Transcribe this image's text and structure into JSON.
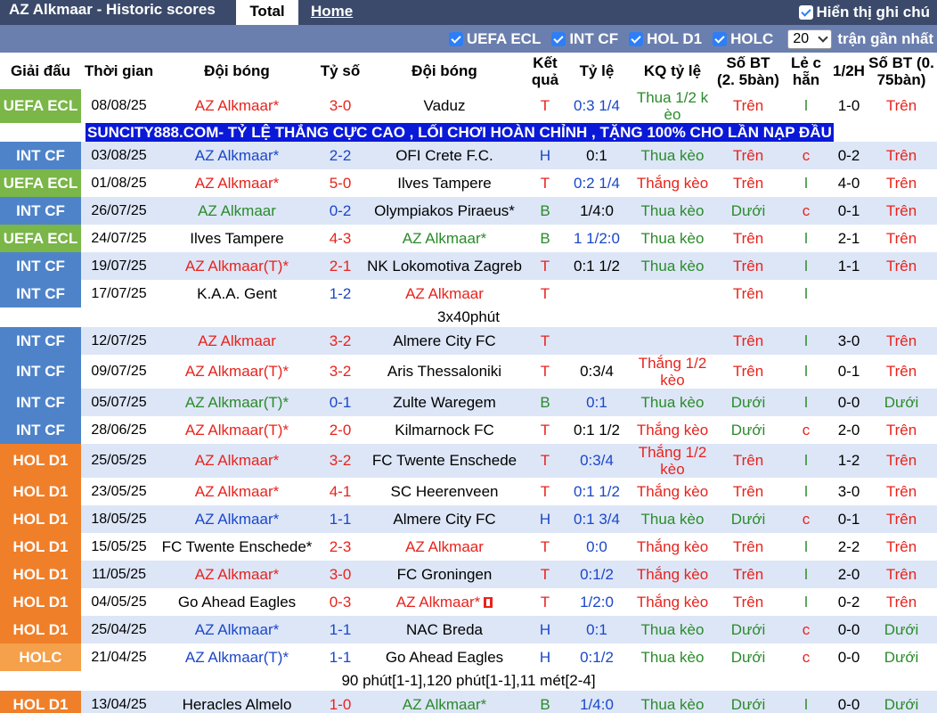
{
  "header": {
    "title": "AZ Alkmaar - Historic scores",
    "tab_total": "Total",
    "tab_home": "Home",
    "show_label": "Hiển thị ghi chú"
  },
  "filters": {
    "items": [
      "UEFA ECL",
      "INT CF",
      "HOL D1",
      "HOLC"
    ],
    "count": "20",
    "recent_label": "trận gần nhất"
  },
  "columns": [
    "Giải đấu",
    "Thời gian",
    "Đội bóng",
    "Tỷ số",
    "Đội bóng",
    "Kết quả",
    "Tỷ lệ",
    "KQ tỷ lệ",
    "Số BT (2. 5bàn)",
    "Lẻ c hẵn",
    "1/2H",
    "Số BT (0. 75bàn)"
  ],
  "colors": {
    "UEFA ECL": "#7ab648",
    "INT CF": "#4e83c9",
    "HOL D1": "#f07f2a",
    "HOLC": "#f5a04a",
    "red": "#e8231c",
    "blue": "#1a47c9",
    "green": "#2a8b2a"
  },
  "banner": "SUNCITY888.COM- TỶ LỆ THẮNG CỰC CAO , LỐI CHƠI HOÀN CHỈNH , TẶNG 100% CHO LẦN NẠP ĐẦU",
  "rows": [
    {
      "kind": "match",
      "league": "UEFA ECL",
      "date": "08/08/25",
      "home": "AZ Alkmaar*",
      "home_c": "red",
      "score": "3-0",
      "score_c": "red",
      "away": "Vaduz",
      "away_c": "",
      "res": "T",
      "res_c": "red",
      "odds": "0:3 1/4",
      "odds_c": "blue",
      "kq": "Thua 1/2 k èo",
      "kq_c": "green",
      "ou": "Trên",
      "ou_c": "red",
      "oe": "l",
      "oe_c": "green",
      "half": "1-0",
      "ou2": "Trên",
      "ou2_c": "red",
      "tall": true
    },
    {
      "kind": "banner"
    },
    {
      "kind": "match",
      "league": "INT CF",
      "date": "03/08/25",
      "home": "AZ Alkmaar*",
      "home_c": "blue",
      "score": "2-2",
      "score_c": "blue",
      "away": "OFI Crete F.C.",
      "away_c": "",
      "res": "H",
      "res_c": "blue",
      "odds": "0:1",
      "odds_c": "",
      "kq": "Thua kèo",
      "kq_c": "green",
      "ou": "Trên",
      "ou_c": "red",
      "oe": "c",
      "oe_c": "red",
      "half": "0-2",
      "ou2": "Trên",
      "ou2_c": "red"
    },
    {
      "kind": "match",
      "league": "UEFA ECL",
      "date": "01/08/25",
      "home": "AZ Alkmaar*",
      "home_c": "red",
      "score": "5-0",
      "score_c": "red",
      "away": "Ilves Tampere",
      "away_c": "",
      "res": "T",
      "res_c": "red",
      "odds": "0:2 1/4",
      "odds_c": "blue",
      "kq": "Thắng kèo",
      "kq_c": "red",
      "ou": "Trên",
      "ou_c": "red",
      "oe": "l",
      "oe_c": "green",
      "half": "4-0",
      "ou2": "Trên",
      "ou2_c": "red"
    },
    {
      "kind": "match",
      "league": "INT CF",
      "date": "26/07/25",
      "home": "AZ Alkmaar",
      "home_c": "green",
      "score": "0-2",
      "score_c": "blue",
      "away": "Olympiakos Piraeus*",
      "away_c": "",
      "res": "B",
      "res_c": "green",
      "odds": "1/4:0",
      "odds_c": "",
      "kq": "Thua kèo",
      "kq_c": "green",
      "ou": "Dưới",
      "ou_c": "green",
      "oe": "c",
      "oe_c": "red",
      "half": "0-1",
      "ou2": "Trên",
      "ou2_c": "red"
    },
    {
      "kind": "match",
      "league": "UEFA ECL",
      "date": "24/07/25",
      "home": "Ilves Tampere",
      "home_c": "",
      "score": "4-3",
      "score_c": "red",
      "away": "AZ Alkmaar*",
      "away_c": "green",
      "res": "B",
      "res_c": "green",
      "odds": "1 1/2:0",
      "odds_c": "blue",
      "kq": "Thua kèo",
      "kq_c": "green",
      "ou": "Trên",
      "ou_c": "red",
      "oe": "l",
      "oe_c": "green",
      "half": "2-1",
      "ou2": "Trên",
      "ou2_c": "red"
    },
    {
      "kind": "match",
      "league": "INT CF",
      "date": "19/07/25",
      "home": "AZ Alkmaar(T)*",
      "home_c": "red",
      "score": "2-1",
      "score_c": "red",
      "away": "NK Lokomotiva Zagreb",
      "away_c": "",
      "res": "T",
      "res_c": "red",
      "odds": "0:1 1/2",
      "odds_c": "",
      "kq": "Thua kèo",
      "kq_c": "green",
      "ou": "Trên",
      "ou_c": "red",
      "oe": "l",
      "oe_c": "green",
      "half": "1-1",
      "ou2": "Trên",
      "ou2_c": "red"
    },
    {
      "kind": "match",
      "league": "INT CF",
      "date": "17/07/25",
      "home": "K.A.A. Gent",
      "home_c": "",
      "score": "1-2",
      "score_c": "blue",
      "away": "AZ Alkmaar",
      "away_c": "red",
      "res": "T",
      "res_c": "red",
      "odds": "",
      "odds_c": "",
      "kq": "",
      "kq_c": "",
      "ou": "Trên",
      "ou_c": "red",
      "oe": "l",
      "oe_c": "green",
      "half": "",
      "ou2": "",
      "ou2_c": ""
    },
    {
      "kind": "note",
      "text": "3x40phút"
    },
    {
      "kind": "match",
      "league": "INT CF",
      "date": "12/07/25",
      "home": "AZ Alkmaar",
      "home_c": "red",
      "score": "3-2",
      "score_c": "red",
      "away": "Almere City FC",
      "away_c": "",
      "res": "T",
      "res_c": "red",
      "odds": "",
      "odds_c": "",
      "kq": "",
      "kq_c": "",
      "ou": "Trên",
      "ou_c": "red",
      "oe": "l",
      "oe_c": "green",
      "half": "3-0",
      "ou2": "Trên",
      "ou2_c": "red"
    },
    {
      "kind": "match",
      "league": "INT CF",
      "date": "09/07/25",
      "home": "AZ Alkmaar(T)*",
      "home_c": "red",
      "score": "3-2",
      "score_c": "red",
      "away": "Aris Thessaloniki",
      "away_c": "",
      "res": "T",
      "res_c": "red",
      "odds": "0:3/4",
      "odds_c": "",
      "kq": "Thắng 1/2 kèo",
      "kq_c": "red",
      "ou": "Trên",
      "ou_c": "red",
      "oe": "l",
      "oe_c": "green",
      "half": "0-1",
      "ou2": "Trên",
      "ou2_c": "red",
      "tall": true
    },
    {
      "kind": "match",
      "league": "INT CF",
      "date": "05/07/25",
      "home": "AZ Alkmaar(T)*",
      "home_c": "green",
      "score": "0-1",
      "score_c": "blue",
      "away": "Zulte Waregem",
      "away_c": "",
      "res": "B",
      "res_c": "green",
      "odds": "0:1",
      "odds_c": "blue",
      "kq": "Thua kèo",
      "kq_c": "green",
      "ou": "Dưới",
      "ou_c": "green",
      "oe": "l",
      "oe_c": "green",
      "half": "0-0",
      "ou2": "Dưới",
      "ou2_c": "green"
    },
    {
      "kind": "match",
      "league": "INT CF",
      "date": "28/06/25",
      "home": "AZ Alkmaar(T)*",
      "home_c": "red",
      "score": "2-0",
      "score_c": "red",
      "away": "Kilmarnock FC",
      "away_c": "",
      "res": "T",
      "res_c": "red",
      "odds": "0:1 1/2",
      "odds_c": "",
      "kq": "Thắng kèo",
      "kq_c": "red",
      "ou": "Dưới",
      "ou_c": "green",
      "oe": "c",
      "oe_c": "red",
      "half": "2-0",
      "ou2": "Trên",
      "ou2_c": "red"
    },
    {
      "kind": "match",
      "league": "HOL D1",
      "date": "25/05/25",
      "home": "AZ Alkmaar*",
      "home_c": "red",
      "score": "3-2",
      "score_c": "red",
      "away": "FC Twente Enschede",
      "away_c": "",
      "res": "T",
      "res_c": "red",
      "odds": "0:3/4",
      "odds_c": "blue",
      "kq": "Thắng 1/2 kèo",
      "kq_c": "red",
      "ou": "Trên",
      "ou_c": "red",
      "oe": "l",
      "oe_c": "green",
      "half": "1-2",
      "ou2": "Trên",
      "ou2_c": "red",
      "tall": true
    },
    {
      "kind": "match",
      "league": "HOL D1",
      "date": "23/05/25",
      "home": "AZ Alkmaar*",
      "home_c": "red",
      "score": "4-1",
      "score_c": "red",
      "away": "SC Heerenveen",
      "away_c": "",
      "res": "T",
      "res_c": "red",
      "odds": "0:1 1/2",
      "odds_c": "blue",
      "kq": "Thắng kèo",
      "kq_c": "red",
      "ou": "Trên",
      "ou_c": "red",
      "oe": "l",
      "oe_c": "green",
      "half": "3-0",
      "ou2": "Trên",
      "ou2_c": "red"
    },
    {
      "kind": "match",
      "league": "HOL D1",
      "date": "18/05/25",
      "home": "AZ Alkmaar*",
      "home_c": "blue",
      "score": "1-1",
      "score_c": "blue",
      "away": "Almere City FC",
      "away_c": "",
      "res": "H",
      "res_c": "blue",
      "odds": "0:1 3/4",
      "odds_c": "blue",
      "kq": "Thua kèo",
      "kq_c": "green",
      "ou": "Dưới",
      "ou_c": "green",
      "oe": "c",
      "oe_c": "red",
      "half": "0-1",
      "ou2": "Trên",
      "ou2_c": "red"
    },
    {
      "kind": "match",
      "league": "HOL D1",
      "date": "15/05/25",
      "home": "FC Twente Enschede*",
      "home_c": "",
      "score": "2-3",
      "score_c": "red",
      "away": "AZ Alkmaar",
      "away_c": "red",
      "res": "T",
      "res_c": "red",
      "odds": "0:0",
      "odds_c": "blue",
      "kq": "Thắng kèo",
      "kq_c": "red",
      "ou": "Trên",
      "ou_c": "red",
      "oe": "l",
      "oe_c": "green",
      "half": "2-2",
      "ou2": "Trên",
      "ou2_c": "red"
    },
    {
      "kind": "match",
      "league": "HOL D1",
      "date": "11/05/25",
      "home": "AZ Alkmaar*",
      "home_c": "red",
      "score": "3-0",
      "score_c": "red",
      "away": "FC Groningen",
      "away_c": "",
      "res": "T",
      "res_c": "red",
      "odds": "0:1/2",
      "odds_c": "blue",
      "kq": "Thắng kèo",
      "kq_c": "red",
      "ou": "Trên",
      "ou_c": "red",
      "oe": "l",
      "oe_c": "green",
      "half": "2-0",
      "ou2": "Trên",
      "ou2_c": "red"
    },
    {
      "kind": "match",
      "league": "HOL D1",
      "date": "04/05/25",
      "home": "Go Ahead Eagles",
      "home_c": "",
      "score": "0-3",
      "score_c": "red",
      "away": "AZ Alkmaar*",
      "away_c": "red",
      "away_flag": true,
      "res": "T",
      "res_c": "red",
      "odds": "1/2:0",
      "odds_c": "blue",
      "kq": "Thắng kèo",
      "kq_c": "red",
      "ou": "Trên",
      "ou_c": "red",
      "oe": "l",
      "oe_c": "green",
      "half": "0-2",
      "ou2": "Trên",
      "ou2_c": "red"
    },
    {
      "kind": "match",
      "league": "HOL D1",
      "date": "25/04/25",
      "home": "AZ Alkmaar*",
      "home_c": "blue",
      "score": "1-1",
      "score_c": "blue",
      "away": "NAC Breda",
      "away_c": "",
      "res": "H",
      "res_c": "blue",
      "odds": "0:1",
      "odds_c": "blue",
      "kq": "Thua kèo",
      "kq_c": "green",
      "ou": "Dưới",
      "ou_c": "green",
      "oe": "c",
      "oe_c": "red",
      "half": "0-0",
      "ou2": "Dưới",
      "ou2_c": "green"
    },
    {
      "kind": "match",
      "league": "HOLC",
      "date": "21/04/25",
      "home": "AZ Alkmaar(T)*",
      "home_c": "blue",
      "score": "1-1",
      "score_c": "blue",
      "away": "Go Ahead Eagles",
      "away_c": "",
      "res": "H",
      "res_c": "blue",
      "odds": "0:1/2",
      "odds_c": "blue",
      "kq": "Thua kèo",
      "kq_c": "green",
      "ou": "Dưới",
      "ou_c": "green",
      "oe": "c",
      "oe_c": "red",
      "half": "0-0",
      "ou2": "Dưới",
      "ou2_c": "green"
    },
    {
      "kind": "note",
      "text": "90 phút[1-1],120 phút[1-1],11 mét[2-4]"
    },
    {
      "kind": "match",
      "league": "HOL D1",
      "date": "13/04/25",
      "home": "Heracles Almelo",
      "home_c": "",
      "score": "1-0",
      "score_c": "red",
      "away": "AZ Alkmaar*",
      "away_c": "green",
      "res": "B",
      "res_c": "green",
      "odds": "1/4:0",
      "odds_c": "blue",
      "kq": "Thua kèo",
      "kq_c": "green",
      "ou": "Dưới",
      "ou_c": "green",
      "oe": "l",
      "oe_c": "green",
      "half": "0-0",
      "ou2": "Dưới",
      "ou2_c": "green"
    }
  ]
}
